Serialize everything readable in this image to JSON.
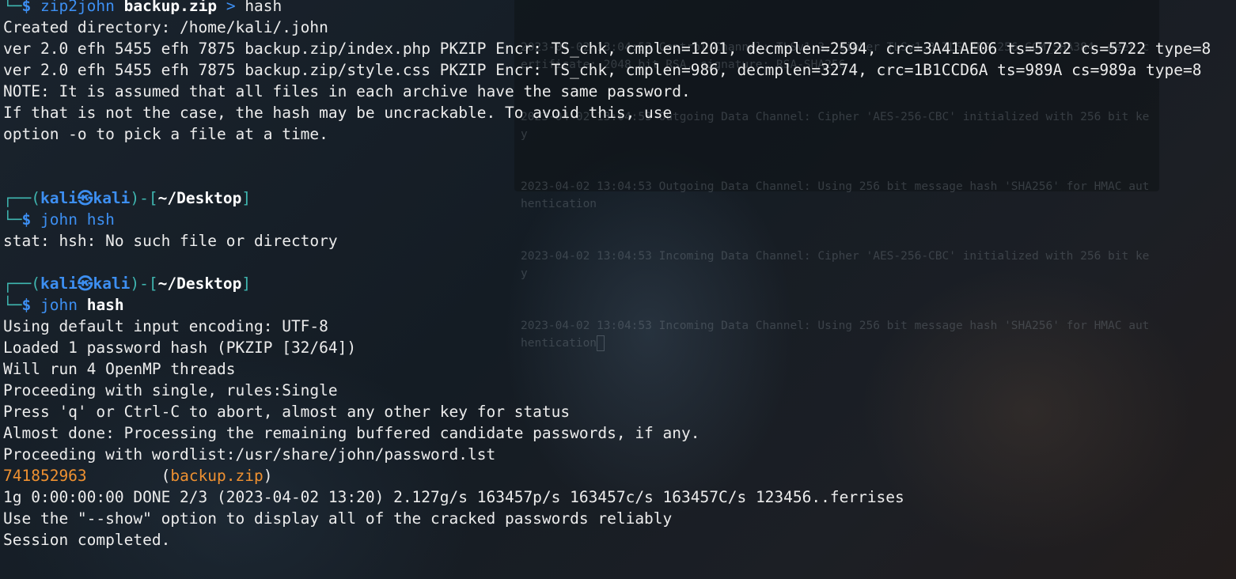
{
  "background_window": {
    "lines": [
      "2023-04-02 13:04:53 Control Channel: TLSv1.3, cipher TLSv1.3 TLS_AES_256_GCM_SHA384, peer certificate: 2048 bit RSA, signature: RSA-SHA256",
      "2023-04-02 13:04:53 Outgoing Data Channel: Cipher 'AES-256-CBC' initialized with 256 bit key",
      "2023-04-02 13:04:53 Outgoing Data Channel: Using 256 bit message hash 'SHA256' for HMAC authentication",
      "2023-04-02 13:04:53 Incoming Data Channel: Cipher 'AES-256-CBC' initialized with 256 bit key",
      "2023-04-02 13:04:53 Incoming Data Channel: Using 256 bit message hash 'SHA256' for HMAC authentication"
    ]
  },
  "prompt": {
    "user": "kali",
    "host": "kali",
    "separator": "㉿",
    "path": "~/Desktop",
    "dollar": "$"
  },
  "block1": {
    "cmd_name": "zip2john",
    "cmd_arg": "backup.zip",
    "redirect": ">",
    "target": "hash",
    "output": [
      "Created directory: /home/kali/.john",
      "ver 2.0 efh 5455 efh 7875 backup.zip/index.php PKZIP Encr: TS_chk, cmplen=1201, decmplen=2594, crc=3A41AE06 ts=5722 cs=5722 type=8",
      "ver 2.0 efh 5455 efh 7875 backup.zip/style.css PKZIP Encr: TS_chk, cmplen=986, decmplen=3274, crc=1B1CCD6A ts=989A cs=989a type=8",
      "NOTE: It is assumed that all files in each archive have the same password.",
      "If that is not the case, the hash may be uncrackable. To avoid this, use",
      "option -o to pick a file at a time."
    ]
  },
  "block2": {
    "cmd_name": "john",
    "cmd_arg": "hsh",
    "output": [
      "stat: hsh: No such file or directory"
    ]
  },
  "block3": {
    "cmd_name": "john",
    "cmd_arg": "hash",
    "output_before": [
      "Using default input encoding: UTF-8",
      "Loaded 1 password hash (PKZIP [32/64])",
      "Will run 4 OpenMP threads",
      "Proceeding with single, rules:Single",
      "Press 'q' or Ctrl-C to abort, almost any other key for status",
      "Almost done: Processing the remaining buffered candidate passwords, if any.",
      "Proceeding with wordlist:/usr/share/john/password.lst"
    ],
    "cracked_password": "741852963",
    "cracked_file": "backup.zip",
    "output_after": [
      "1g 0:00:00:00 DONE 2/3 (2023-04-02 13:20) 2.127g/s 163457p/s 163457c/s 163457C/s 123456..ferrises",
      "Use the \"--show\" option to display all of the cracked passwords reliably",
      "Session completed."
    ]
  },
  "colors": {
    "prompt_blue": "#3d8ff2",
    "prompt_teal": "#3fb6b0",
    "cracked_orange": "#ef9131",
    "text": "#ececec"
  }
}
